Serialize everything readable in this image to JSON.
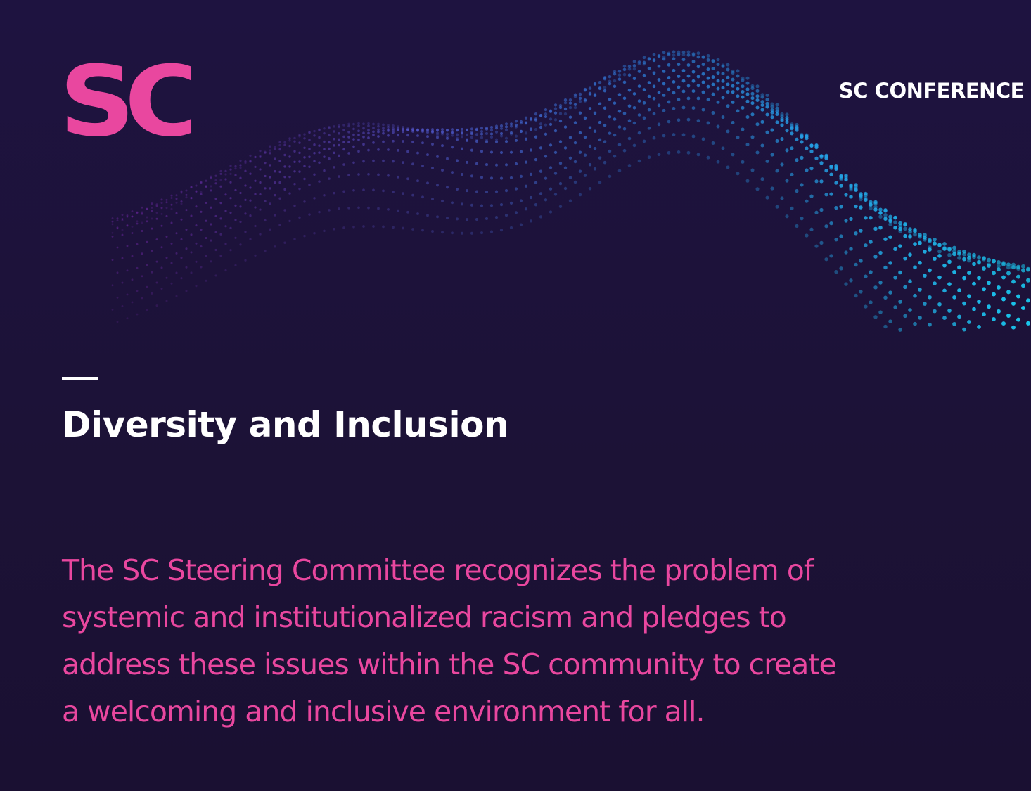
{
  "logo": {
    "text": "SC",
    "color": "#e9479f"
  },
  "header": {
    "label": "SC CONFERENCE"
  },
  "section": {
    "title": "Diversity and Inclusion",
    "statement_lines": [
      "The SC Steering Committee recognizes the problem of",
      "systemic and institutionalized racism and pledges to",
      "address these issues within the SC community to create",
      "a welcoming and inclusive environment for all."
    ]
  },
  "colors": {
    "background": "#1d1238",
    "accent_pink": "#e9479f",
    "particle_purple": "#8b2fc9",
    "particle_blue": "#2f7fe0",
    "particle_cyan": "#19c9ee",
    "text_white": "#ffffff"
  }
}
